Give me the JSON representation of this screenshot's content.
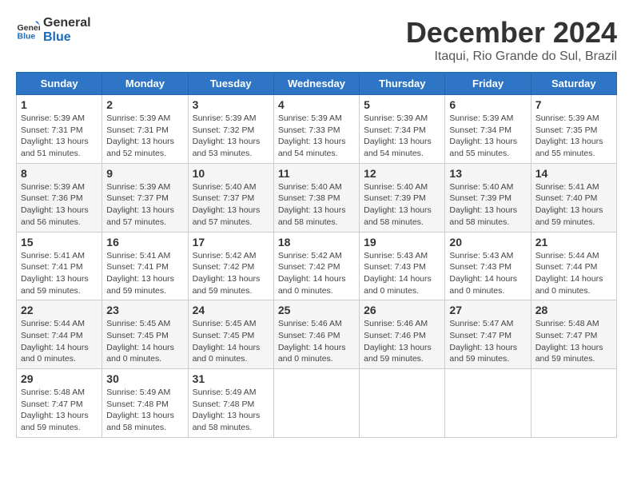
{
  "header": {
    "logo_line1": "General",
    "logo_line2": "Blue",
    "month_title": "December 2024",
    "location": "Itaqui, Rio Grande do Sul, Brazil"
  },
  "weekdays": [
    "Sunday",
    "Monday",
    "Tuesday",
    "Wednesday",
    "Thursday",
    "Friday",
    "Saturday"
  ],
  "weeks": [
    [
      {
        "day": "1",
        "sunrise": "5:39 AM",
        "sunset": "7:31 PM",
        "daylight": "13 hours and 51 minutes."
      },
      {
        "day": "2",
        "sunrise": "5:39 AM",
        "sunset": "7:31 PM",
        "daylight": "13 hours and 52 minutes."
      },
      {
        "day": "3",
        "sunrise": "5:39 AM",
        "sunset": "7:32 PM",
        "daylight": "13 hours and 53 minutes."
      },
      {
        "day": "4",
        "sunrise": "5:39 AM",
        "sunset": "7:33 PM",
        "daylight": "13 hours and 54 minutes."
      },
      {
        "day": "5",
        "sunrise": "5:39 AM",
        "sunset": "7:34 PM",
        "daylight": "13 hours and 54 minutes."
      },
      {
        "day": "6",
        "sunrise": "5:39 AM",
        "sunset": "7:34 PM",
        "daylight": "13 hours and 55 minutes."
      },
      {
        "day": "7",
        "sunrise": "5:39 AM",
        "sunset": "7:35 PM",
        "daylight": "13 hours and 55 minutes."
      }
    ],
    [
      {
        "day": "8",
        "sunrise": "5:39 AM",
        "sunset": "7:36 PM",
        "daylight": "13 hours and 56 minutes."
      },
      {
        "day": "9",
        "sunrise": "5:39 AM",
        "sunset": "7:37 PM",
        "daylight": "13 hours and 57 minutes."
      },
      {
        "day": "10",
        "sunrise": "5:40 AM",
        "sunset": "7:37 PM",
        "daylight": "13 hours and 57 minutes."
      },
      {
        "day": "11",
        "sunrise": "5:40 AM",
        "sunset": "7:38 PM",
        "daylight": "13 hours and 58 minutes."
      },
      {
        "day": "12",
        "sunrise": "5:40 AM",
        "sunset": "7:39 PM",
        "daylight": "13 hours and 58 minutes."
      },
      {
        "day": "13",
        "sunrise": "5:40 AM",
        "sunset": "7:39 PM",
        "daylight": "13 hours and 58 minutes."
      },
      {
        "day": "14",
        "sunrise": "5:41 AM",
        "sunset": "7:40 PM",
        "daylight": "13 hours and 59 minutes."
      }
    ],
    [
      {
        "day": "15",
        "sunrise": "5:41 AM",
        "sunset": "7:41 PM",
        "daylight": "13 hours and 59 minutes."
      },
      {
        "day": "16",
        "sunrise": "5:41 AM",
        "sunset": "7:41 PM",
        "daylight": "13 hours and 59 minutes."
      },
      {
        "day": "17",
        "sunrise": "5:42 AM",
        "sunset": "7:42 PM",
        "daylight": "13 hours and 59 minutes."
      },
      {
        "day": "18",
        "sunrise": "5:42 AM",
        "sunset": "7:42 PM",
        "daylight": "14 hours and 0 minutes."
      },
      {
        "day": "19",
        "sunrise": "5:43 AM",
        "sunset": "7:43 PM",
        "daylight": "14 hours and 0 minutes."
      },
      {
        "day": "20",
        "sunrise": "5:43 AM",
        "sunset": "7:43 PM",
        "daylight": "14 hours and 0 minutes."
      },
      {
        "day": "21",
        "sunrise": "5:44 AM",
        "sunset": "7:44 PM",
        "daylight": "14 hours and 0 minutes."
      }
    ],
    [
      {
        "day": "22",
        "sunrise": "5:44 AM",
        "sunset": "7:44 PM",
        "daylight": "14 hours and 0 minutes."
      },
      {
        "day": "23",
        "sunrise": "5:45 AM",
        "sunset": "7:45 PM",
        "daylight": "14 hours and 0 minutes."
      },
      {
        "day": "24",
        "sunrise": "5:45 AM",
        "sunset": "7:45 PM",
        "daylight": "14 hours and 0 minutes."
      },
      {
        "day": "25",
        "sunrise": "5:46 AM",
        "sunset": "7:46 PM",
        "daylight": "14 hours and 0 minutes."
      },
      {
        "day": "26",
        "sunrise": "5:46 AM",
        "sunset": "7:46 PM",
        "daylight": "13 hours and 59 minutes."
      },
      {
        "day": "27",
        "sunrise": "5:47 AM",
        "sunset": "7:47 PM",
        "daylight": "13 hours and 59 minutes."
      },
      {
        "day": "28",
        "sunrise": "5:48 AM",
        "sunset": "7:47 PM",
        "daylight": "13 hours and 59 minutes."
      }
    ],
    [
      {
        "day": "29",
        "sunrise": "5:48 AM",
        "sunset": "7:47 PM",
        "daylight": "13 hours and 59 minutes."
      },
      {
        "day": "30",
        "sunrise": "5:49 AM",
        "sunset": "7:48 PM",
        "daylight": "13 hours and 58 minutes."
      },
      {
        "day": "31",
        "sunrise": "5:49 AM",
        "sunset": "7:48 PM",
        "daylight": "13 hours and 58 minutes."
      },
      null,
      null,
      null,
      null
    ]
  ],
  "labels": {
    "sunrise": "Sunrise:",
    "sunset": "Sunset:",
    "daylight": "Daylight:"
  }
}
